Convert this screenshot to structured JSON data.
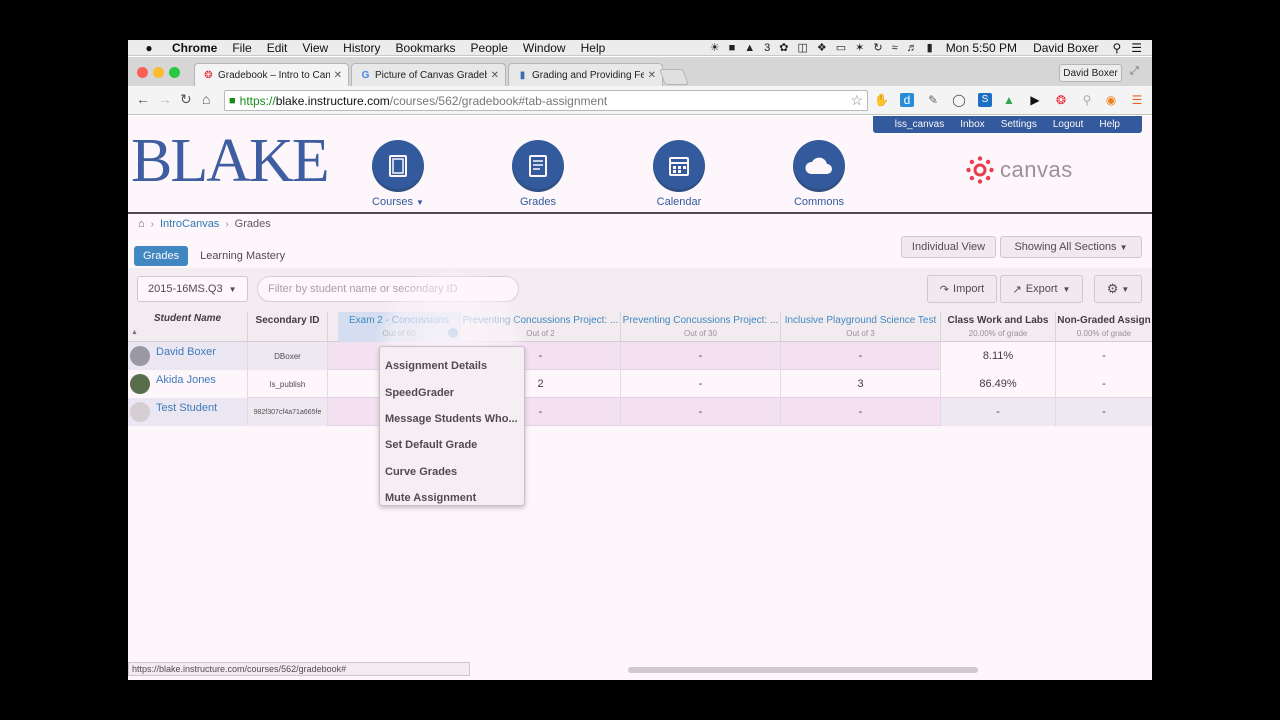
{
  "menubar": {
    "app": "Chrome",
    "items": [
      "File",
      "Edit",
      "View",
      "History",
      "Bookmarks",
      "People",
      "Window",
      "Help"
    ],
    "tray_text": "3",
    "clock": "Mon 5:50 PM",
    "user": "David Boxer"
  },
  "tabs": [
    {
      "label": "Gradebook – Intro to Canv"
    },
    {
      "label": "Picture of Canvas Gradebo"
    },
    {
      "label": "Grading and Providing Fe"
    }
  ],
  "profile_label": "David Boxer",
  "address": {
    "scheme": "https://",
    "host": "blake.instructure.com",
    "path": "/courses/562/gradebook#tab-assignment"
  },
  "header": {
    "logo_text": "BLAKE",
    "util_links": [
      "lss_canvas",
      "Inbox",
      "Settings",
      "Logout",
      "Help"
    ],
    "nav": [
      {
        "label": "Courses"
      },
      {
        "label": "Grades"
      },
      {
        "label": "Calendar"
      },
      {
        "label": "Commons"
      }
    ],
    "canvas_text": "canvas"
  },
  "breadcrumb": {
    "course": "IntroCanvas",
    "page": "Grades"
  },
  "gradebook_tabs": {
    "grades": "Grades",
    "learning_mastery": "Learning Mastery"
  },
  "buttons": {
    "individual_view": "Individual View",
    "sections": "Showing All Sections",
    "import": "Import",
    "export": "Export"
  },
  "term_select": "2015-16MS.Q3",
  "filter": {
    "placeholder": "Filter by student name or secondary ID"
  },
  "columns": [
    {
      "title": "Student Name",
      "sub": ""
    },
    {
      "title": "Secondary ID",
      "sub": ""
    },
    {
      "title": "Exam 2 - Concussions",
      "sub": "Out of 60"
    },
    {
      "title": "Preventing Concussions Project: ...",
      "sub": "Out of 2"
    },
    {
      "title": "Preventing Concussions Project: ...",
      "sub": "Out of 30"
    },
    {
      "title": "Inclusive Playground Science Test",
      "sub": "Out of 3"
    },
    {
      "title": "Class Work and Labs",
      "sub": "20.00% of grade"
    },
    {
      "title": "Non-Graded Assign",
      "sub": "0.00% of grade"
    }
  ],
  "students": [
    {
      "name": "David Boxer",
      "secondary_id": "DBoxer",
      "c2": "-",
      "c3": "-",
      "c4": "-",
      "c5": "8.11%",
      "c6": "-"
    },
    {
      "name": "Akida Jones",
      "secondary_id": "ls_publish",
      "c2": "2",
      "c3": "-",
      "c4": "3",
      "c5": "86.49%",
      "c6": "-"
    },
    {
      "name": "Test Student",
      "secondary_id": "982f307cf4a71a665fe",
      "c2": "-",
      "c3": "-",
      "c4": "-",
      "c5": "-",
      "c6": "-"
    }
  ],
  "menu": {
    "items": [
      "Assignment Details",
      "SpeedGrader",
      "Message Students Who...",
      "Set Default Grade",
      "Curve Grades",
      "Mute Assignment"
    ]
  },
  "statusbar": "https://blake.instructure.com/courses/562/gradebook#",
  "colors": {
    "accent": "#1e7db8",
    "nav_blue": "#0e468e",
    "canvas_red": "#e4242f"
  }
}
